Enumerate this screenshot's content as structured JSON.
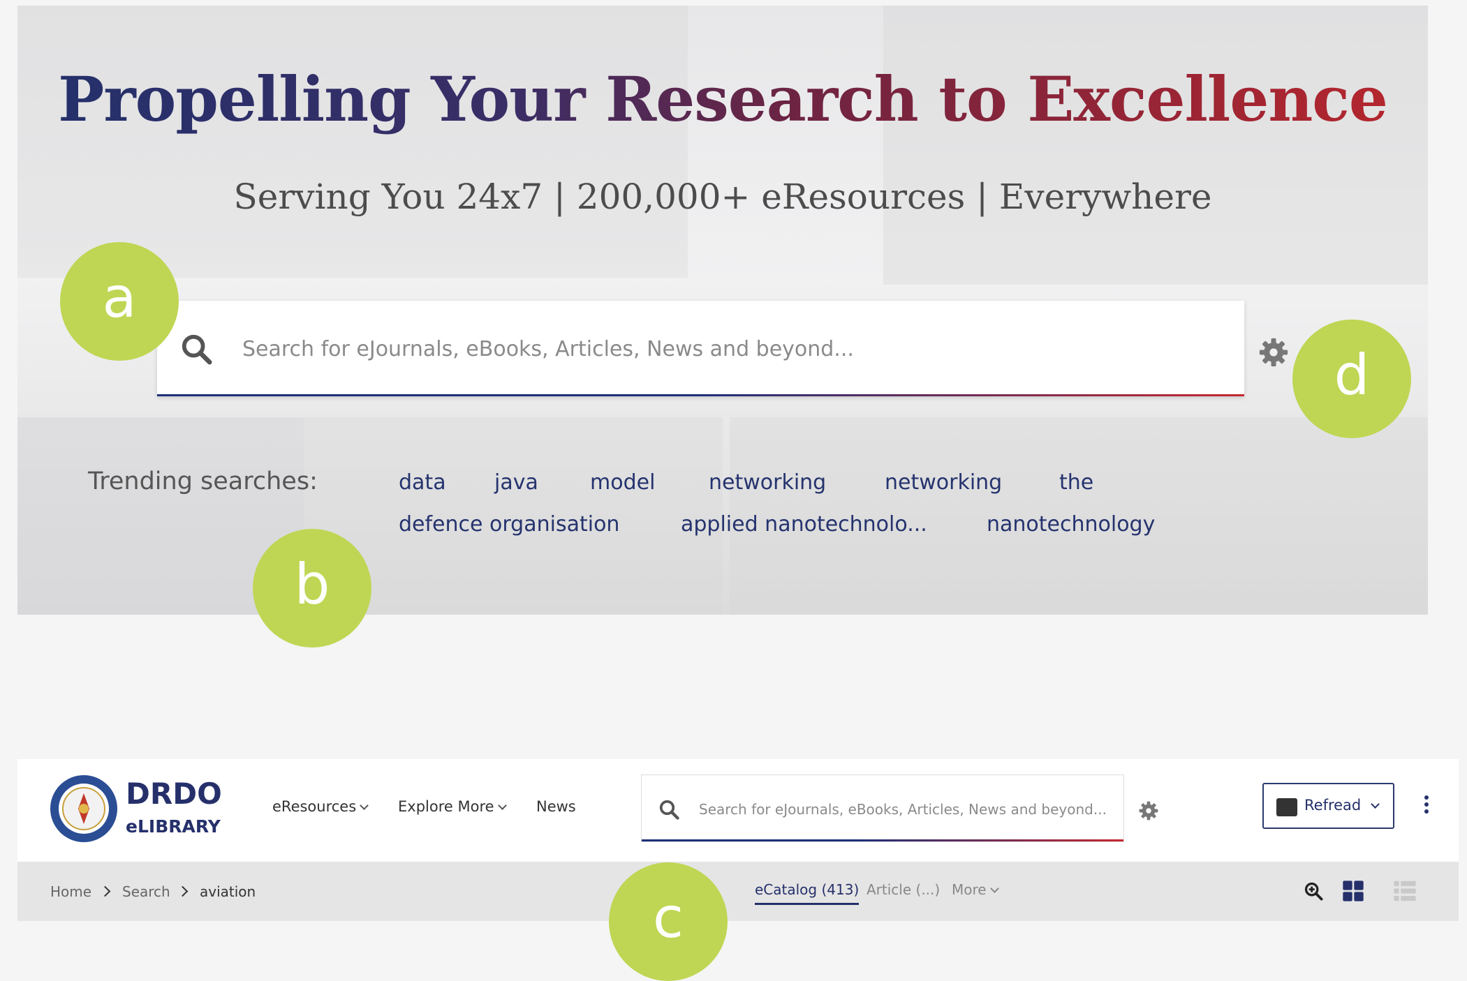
{
  "hero": {
    "title": "Propelling Your Research to Excellence",
    "subtitle": "Serving You 24x7 | 200,000+ eResources | Everywhere",
    "search_placeholder": "Search for eJournals, eBooks, Articles, News and beyond...",
    "trending_label": "Trending searches:",
    "trending": [
      "data",
      "java",
      "model",
      "networking",
      "networking",
      "the",
      "defence organisation",
      "applied nanotechnolo...",
      "nanotechnology"
    ]
  },
  "navbar": {
    "brand_top": "DRDO",
    "brand_bottom": "eLIBRARY",
    "links": [
      "eResources",
      "Explore More",
      "News"
    ],
    "search_placeholder": "Search for eJournals, eBooks, Articles, News and beyond...",
    "refread_label": "Refread"
  },
  "subbar": {
    "breadcrumb": [
      "Home",
      "Search",
      "aviation"
    ],
    "tabs": [
      "eCatalog (413)",
      "Article (...)",
      "More"
    ]
  },
  "markers": [
    "a",
    "b",
    "c",
    "d"
  ],
  "colors": {
    "navy": "#25306b",
    "red": "#b8262c",
    "marker": "#bed653"
  },
  "icons": [
    "search-icon",
    "gear-icon",
    "chevron-down-icon",
    "kebab-menu-icon",
    "zoom-icon",
    "grid-view-icon",
    "list-view-icon"
  ]
}
